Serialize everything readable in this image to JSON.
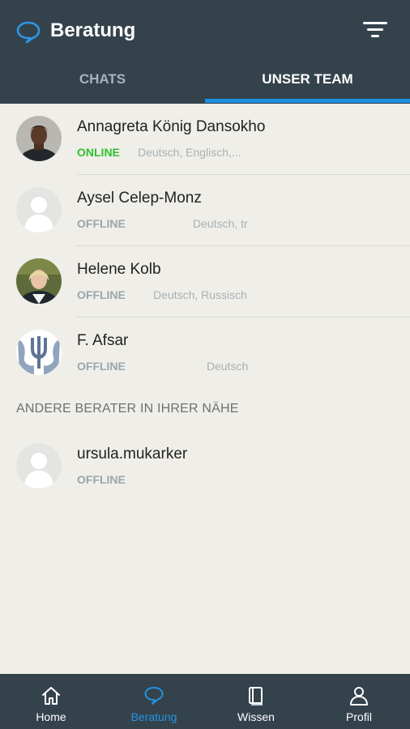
{
  "header": {
    "title": "Beratung",
    "icons": {
      "app": "speech-bubble-icon",
      "filter": "filter-icon"
    }
  },
  "tabs": [
    {
      "label": "CHATS",
      "active": false
    },
    {
      "label": "UNSER TEAM",
      "active": true
    }
  ],
  "team": [
    {
      "name": "Annagreta König Dansokho",
      "status": "ONLINE",
      "languages": "Deutsch, Englisch,..."
    },
    {
      "name": "Aysel Celep-Monz",
      "status": "OFFLINE",
      "languages": "Deutsch, tr"
    },
    {
      "name": "Helene Kolb",
      "status": "OFFLINE",
      "languages": "Deutsch, Russisch"
    },
    {
      "name": "F. Afsar",
      "status": "OFFLINE",
      "languages": "Deutsch"
    }
  ],
  "nearby": {
    "header": "ANDERE BERATER IN IHRER NÄHE",
    "items": [
      {
        "name": "ursula.mukarker",
        "status": "OFFLINE"
      }
    ]
  },
  "bottom_nav": [
    {
      "label": "Home",
      "icon": "home-icon",
      "active": false
    },
    {
      "label": "Beratung",
      "icon": "speech-bubble-icon",
      "active": true
    },
    {
      "label": "Wissen",
      "icon": "book-icon",
      "active": false
    },
    {
      "label": "Profil",
      "icon": "person-icon",
      "active": false
    }
  ],
  "colors": {
    "bar": "#34424c",
    "accent": "#1e8fe0",
    "online": "#2fc02f",
    "background": "#efeee8"
  }
}
